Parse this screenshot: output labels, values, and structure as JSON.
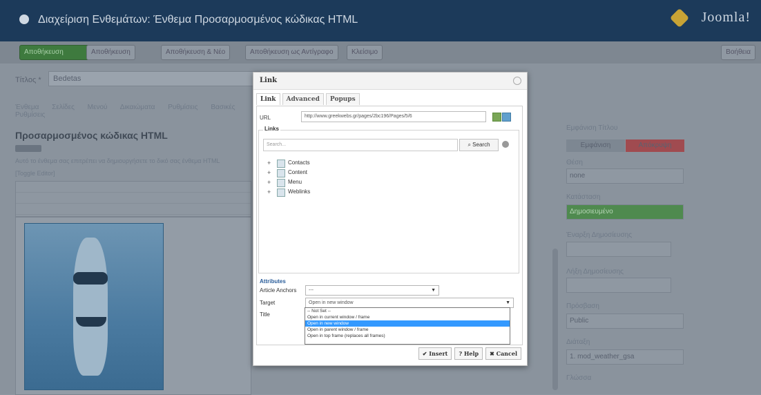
{
  "header": {
    "title": "Διαχείριση Ενθεμάτων: Ένθεμα Προσαρμοσμένος κώδικας HTML",
    "logo_text": "Joomla!"
  },
  "toolbar": {
    "buttons": [
      "Αποθήκευση",
      "Αποθήκευση",
      "Αποθήκευση & Νέο",
      "Αποθήκευση ως Αντίγραφο",
      "Κλείσιμο"
    ],
    "help_label": "Βοήθεια"
  },
  "left": {
    "title_label": "Τίτλος *",
    "title_value": "Bedetas",
    "tabs": "Ένθεμα Σελίδες Μενού Δικαιώματα Ρυθμίσεις Βασικές Ρυθμίσεις",
    "heading": "Προσαρμοσμένος κώδικας HTML",
    "description": "Αυτό το ένθεμα σας επιτρέπει να δημιουργήσετε το δικό σας ένθεμα HTML",
    "toggle": "[Toggle Editor]"
  },
  "right": {
    "show_title_label": "Εμφάνιση Τίτλου",
    "show_title_yes": "Εμφάνιση",
    "show_title_no": "Απόκρυψη",
    "position_label": "Θέση",
    "position_value": "none",
    "status_label": "Κατάσταση",
    "status_value": "Δημοσιευμένο",
    "start_label": "Έναρξη Δημοσίευσης",
    "finish_label": "Λήξη Δημοσίευσης",
    "access_label": "Πρόσβαση",
    "access_value": "Public",
    "order_label": "Διάταξη",
    "order_value": "1. mod_weather_gsa",
    "language_label": "Γλώσσα"
  },
  "dialog": {
    "title": "Link",
    "tabs": [
      "Link",
      "Advanced",
      "Popups"
    ],
    "url_label": "URL",
    "url_value": "http://www.greekwebs.gr/pages/2bc196/Pages/5/6",
    "links_legend": "Links",
    "search_placeholder": "Search...",
    "search_button": "Search",
    "tree": [
      "Contacts",
      "Content",
      "Menu",
      "Weblinks"
    ],
    "attributes_title": "Attributes",
    "article_anchors_label": "Article Anchors",
    "article_anchors_value": "---",
    "target_label": "Target",
    "target_value": "Open in new window",
    "title_label": "Title",
    "target_options": [
      "-- Not Set --",
      "Open in current window / frame",
      "Open in new window",
      "Open in parent window / frame",
      "Open in top frame (replaces all frames)"
    ],
    "buttons": [
      "Insert",
      "Help",
      "Cancel"
    ]
  }
}
